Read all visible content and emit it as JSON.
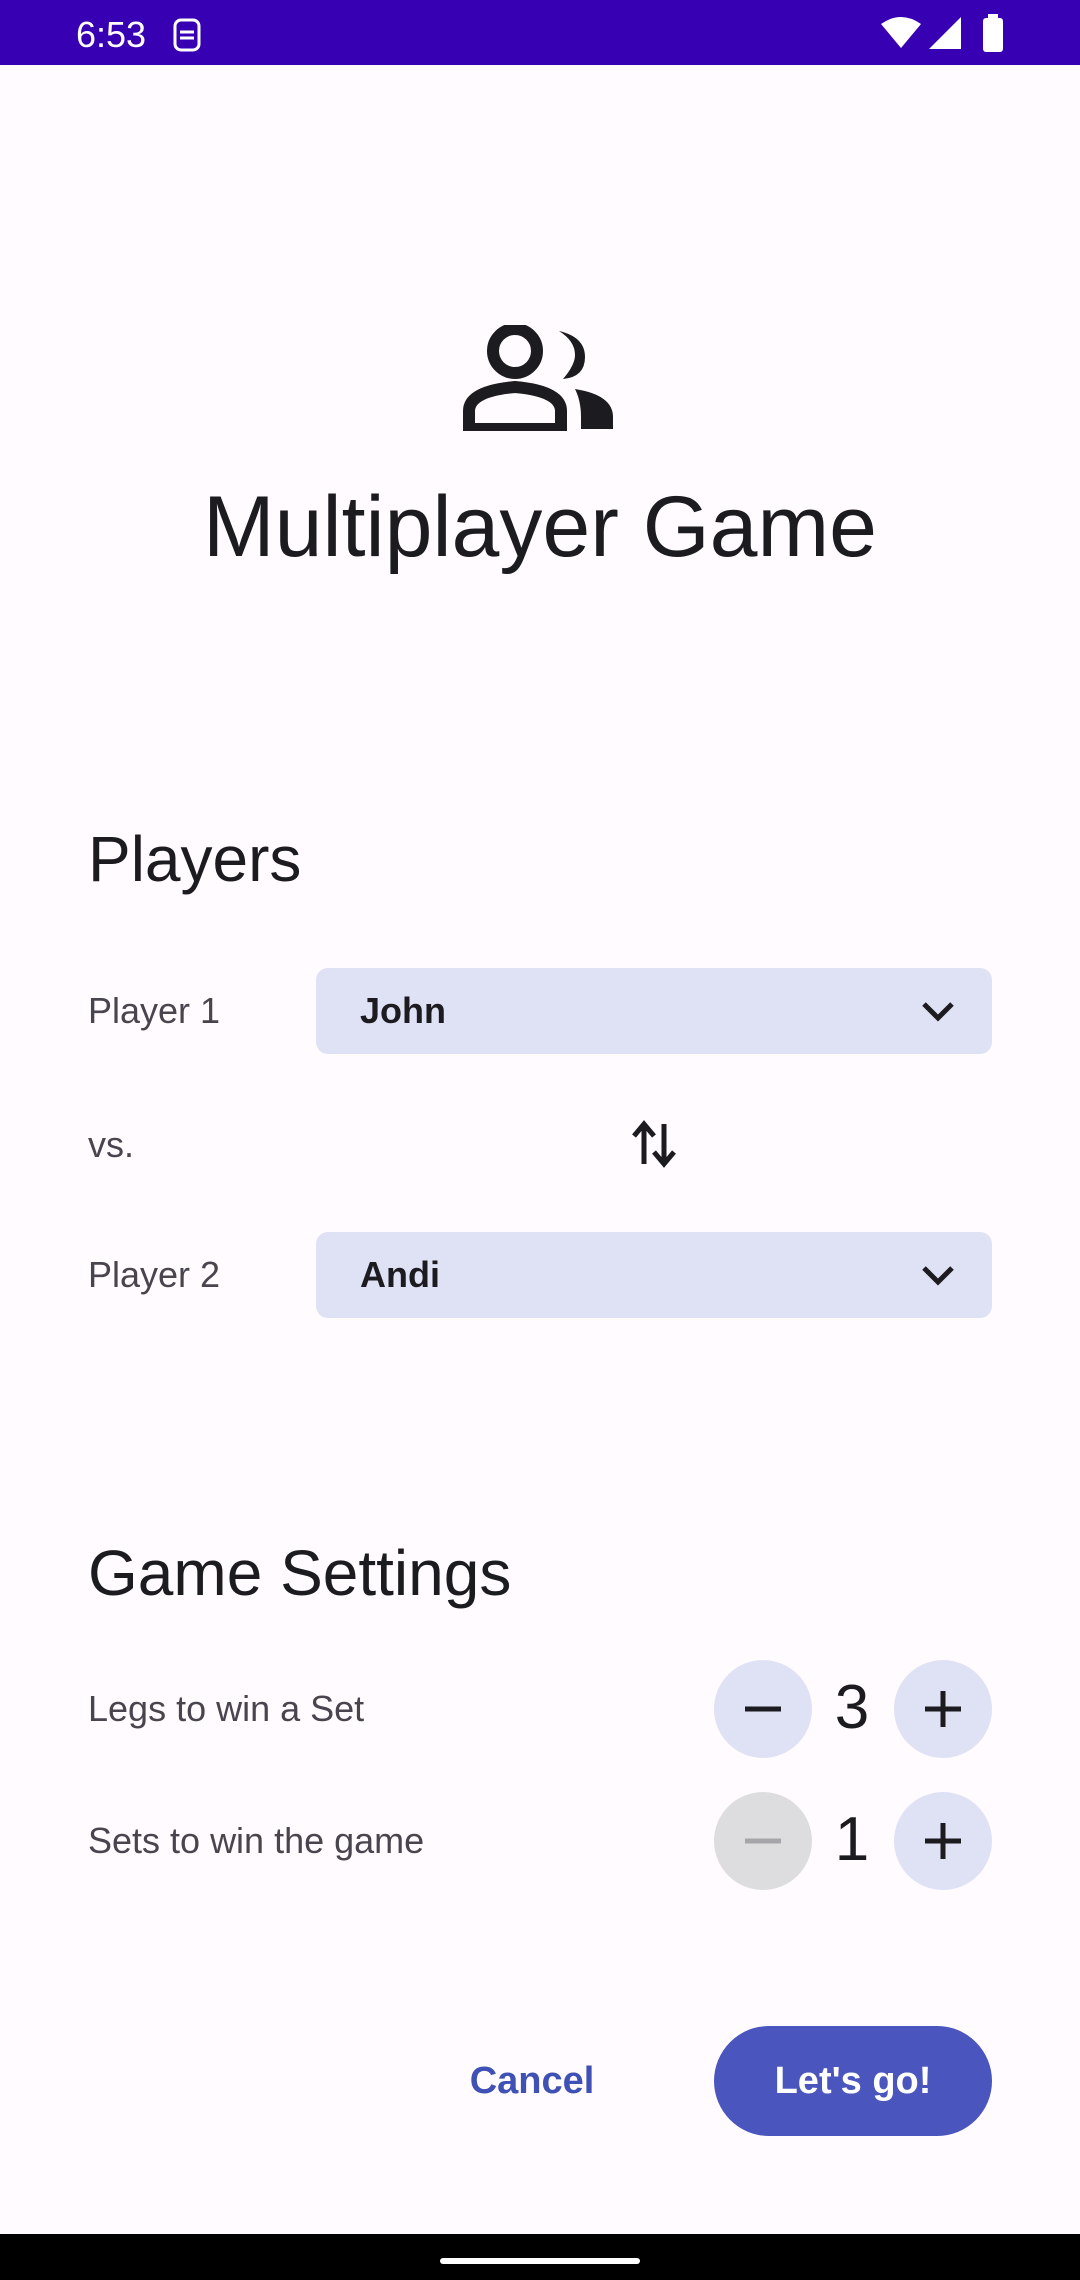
{
  "status_bar": {
    "time": "6:53"
  },
  "header": {
    "icon": "group-icon",
    "title": "Multiplayer Game"
  },
  "players": {
    "section_title": "Players",
    "player1": {
      "label": "Player 1",
      "value": "John"
    },
    "vs_label": "vs.",
    "player2": {
      "label": "Player 2",
      "value": "Andi"
    }
  },
  "settings": {
    "section_title": "Game Settings",
    "legs": {
      "label": "Legs to win a Set",
      "value": "3"
    },
    "sets": {
      "label": "Sets to win the game",
      "value": "1"
    }
  },
  "actions": {
    "cancel_label": "Cancel",
    "go_label": "Let's go!"
  },
  "colors": {
    "accent": "#4A56BE",
    "status_bar": "#3700B3",
    "field_bg": "#DFE1F5",
    "background": "#FFFBFE"
  }
}
